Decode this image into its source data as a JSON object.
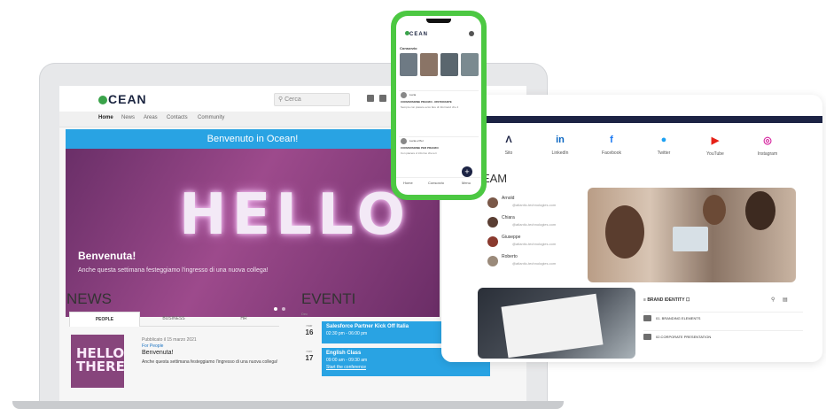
{
  "laptop": {
    "logo": "CEAN",
    "search_placeholder": "Cerca",
    "nav": [
      "Home",
      "News",
      "Areas",
      "Contacts",
      "Community"
    ],
    "banner": {
      "title": "Benvenuto in Ocean!",
      "hero_text": "HELLO",
      "welcome": "Benvenuta!",
      "welcome_sub": "Anche questa settimana festeggiamo l'ingresso di una nuova collega!"
    },
    "news": {
      "title": "NEWS",
      "tabs": [
        "PEOPLE",
        "BUSINESS",
        "HR"
      ],
      "item": {
        "meta": "Pubblicato il 15 marzo 2021",
        "tag": "For People",
        "headline": "Benvenuta!",
        "text": "Anche questa settimana festeggiamo l'ingresso di una nuova collega!",
        "thumb_text": "HELLO THERE"
      }
    },
    "events": {
      "title": "EVENTI",
      "month": "Dec",
      "items": [
        {
          "day": "mar",
          "date": "16",
          "title": "Salesforce Partner Kick Off Italia",
          "time": "02:30 pm - 06:00 pm"
        },
        {
          "day": "mer",
          "date": "17",
          "title": "English Class",
          "time": "09:00 am - 09:30 am",
          "link": "Start the conference"
        }
      ]
    }
  },
  "tablet": {
    "social": [
      {
        "icon": "site-icon",
        "glyph": "Λ",
        "label": "Sito",
        "color": "#1c2344"
      },
      {
        "icon": "linkedin-icon",
        "glyph": "in",
        "label": "LinkedIn",
        "color": "#0a66c2"
      },
      {
        "icon": "facebook-icon",
        "glyph": "f",
        "label": "Facebook",
        "color": "#1877f2"
      },
      {
        "icon": "twitter-icon",
        "glyph": "●",
        "label": "Twitter",
        "color": "#1da1f2"
      },
      {
        "icon": "youtube-icon",
        "glyph": "▶",
        "label": "YouTube",
        "color": "#e62117"
      },
      {
        "icon": "instagram-icon",
        "glyph": "◎",
        "label": "Instagram",
        "color": "#d6249f"
      }
    ],
    "team_title": "TEAM",
    "members": [
      {
        "name": "Arnold",
        "email": "@atlantic-technologies.com"
      },
      {
        "name": "Chiara",
        "email": "@atlantic-technologies.com"
      },
      {
        "name": "Giuseppe",
        "email": "@atlantic-technologies.com"
      },
      {
        "name": "Roberto",
        "email": "@atlantic-technologies.com"
      }
    ],
    "brand_identity": "BRAND IDENTITY",
    "folders": [
      "01. BRANDING ELEMENTS",
      "02.CORPORATE PRESENTATION"
    ]
  },
  "phone": {
    "logo": "CEAN",
    "section": "Consorzio",
    "posts": [
      {
        "name": "Lucia",
        "headline": "CONVERSIONE PRANZO - RISTORANTE",
        "text": "Sempre con piacere ecco fare di informarvi che il"
      },
      {
        "name": "Lucia e Pier",
        "headline": "CONVERSIONE PER PRANZO",
        "text": "Con piacere vi informo che ieri"
      }
    ],
    "bottom": [
      "Home",
      "Consorzio",
      "Menu"
    ]
  },
  "colors": {
    "accent": "#29a3e3",
    "brand": "#1c2344",
    "green": "#3aa34a",
    "phone_frame": "#4cc842"
  }
}
